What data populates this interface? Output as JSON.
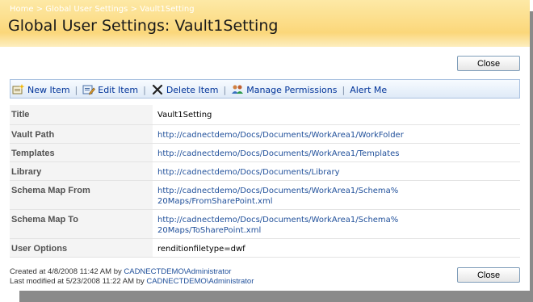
{
  "breadcrumb": {
    "home": "Home",
    "sep": ">",
    "settings": "Global User Settings",
    "current": "Vault1Setting"
  },
  "page_title": "Global User Settings: Vault1Setting",
  "buttons": {
    "close": "Close"
  },
  "toolbar": {
    "new_item": "New Item",
    "edit_item": "Edit Item",
    "delete_item": "Delete Item",
    "manage_permissions": "Manage Permissions",
    "alert_me": "Alert Me",
    "separator": "|"
  },
  "properties": [
    {
      "label": "Title",
      "value": "Vault1Setting"
    },
    {
      "label": "Vault Path",
      "value": "http://cadnectdemo/Docs/Documents/WorkArea1/WorkFolder"
    },
    {
      "label": "Templates",
      "value": "http://cadnectdemo/Docs/Documents/WorkArea1/Templates"
    },
    {
      "label": "Library",
      "value": "http://cadnectdemo/Docs/Documents/Library"
    },
    {
      "label": "Schema Map From",
      "value_line1": "http://cadnectdemo/Docs/Documents/WorkArea1/Schema%",
      "value_line2": "20Maps/FromSharePoint.xml"
    },
    {
      "label": "Schema Map To",
      "value_line1": "http://cadnectdemo/Docs/Documents/WorkArea1/Schema%",
      "value_line2": "20Maps/ToSharePoint.xml"
    },
    {
      "label": "User Options",
      "value": "renditionfiletype=dwf"
    }
  ],
  "footer": {
    "created_prefix": "Created at 4/8/2008 11:42 AM  by",
    "created_by": "CADNECTDEMO\\Administrator",
    "modified_prefix": "Last modified at 5/23/2008 11:22 AM  by",
    "modified_by": "CADNECTDEMO\\Administrator"
  }
}
